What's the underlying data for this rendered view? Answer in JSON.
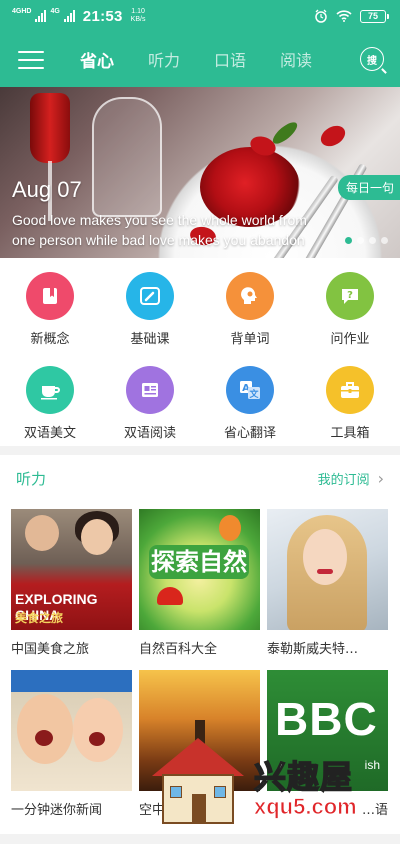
{
  "status_bar": {
    "signal1_tag": "4GHD",
    "signal2_tag": "4G",
    "time": "21:53",
    "speed_value": "1.10",
    "speed_unit": "KB/s",
    "battery": "75"
  },
  "nav": {
    "tabs": [
      {
        "label": "省心",
        "active": true
      },
      {
        "label": "听力",
        "active": false
      },
      {
        "label": "口语",
        "active": false
      },
      {
        "label": "阅读",
        "active": false
      }
    ],
    "search_label": "搜",
    "accent_color": "#2dbb93"
  },
  "banner": {
    "date": "Aug 07",
    "quote_line1": "Good love makes you see the whole world from",
    "quote_line2": "one person while bad love makes you abandon",
    "badge": "每日一句",
    "dots": 4,
    "active_dot": 0
  },
  "features": [
    {
      "label": "新概念",
      "icon": "bookmark-icon",
      "color": "#ef4a6b",
      "glyph": "▮"
    },
    {
      "label": "基础课",
      "icon": "brush-icon",
      "color": "#26b5e8",
      "glyph": "✎"
    },
    {
      "label": "背单词",
      "icon": "head-brain-icon",
      "color": "#f5913a",
      "glyph": "☺"
    },
    {
      "label": "问作业",
      "icon": "question-bubble-icon",
      "color": "#82c341",
      "glyph": "?"
    },
    {
      "label": "双语美文",
      "icon": "cup-icon",
      "color": "#2fc8a3",
      "glyph": "☕"
    },
    {
      "label": "双语阅读",
      "icon": "newspaper-icon",
      "color": "#a073e0",
      "glyph": "▤"
    },
    {
      "label": "省心翻译",
      "icon": "translate-icon",
      "color": "#3a8fe3",
      "glyph": "文"
    },
    {
      "label": "工具箱",
      "icon": "toolbox-icon",
      "color": "#f5c12a",
      "glyph": "▣"
    }
  ],
  "listening": {
    "title": "听力",
    "more": "我的订阅",
    "cards": [
      {
        "title": "中国美食之旅",
        "img_text1": "EXPLORING CHINA",
        "img_text2": "美食之旅"
      },
      {
        "title": "自然百科大全",
        "img_text1": "探索自然"
      },
      {
        "title": "泰勒斯威夫特…"
      },
      {
        "title": "一分钟迷你新闻"
      },
      {
        "title": "空中…"
      },
      {
        "title": "…语",
        "img_text1": "BBC",
        "img_text2": "ish"
      }
    ]
  },
  "watermark": {
    "text_cn": "兴趣屋",
    "text_url": "xqu5.com"
  }
}
